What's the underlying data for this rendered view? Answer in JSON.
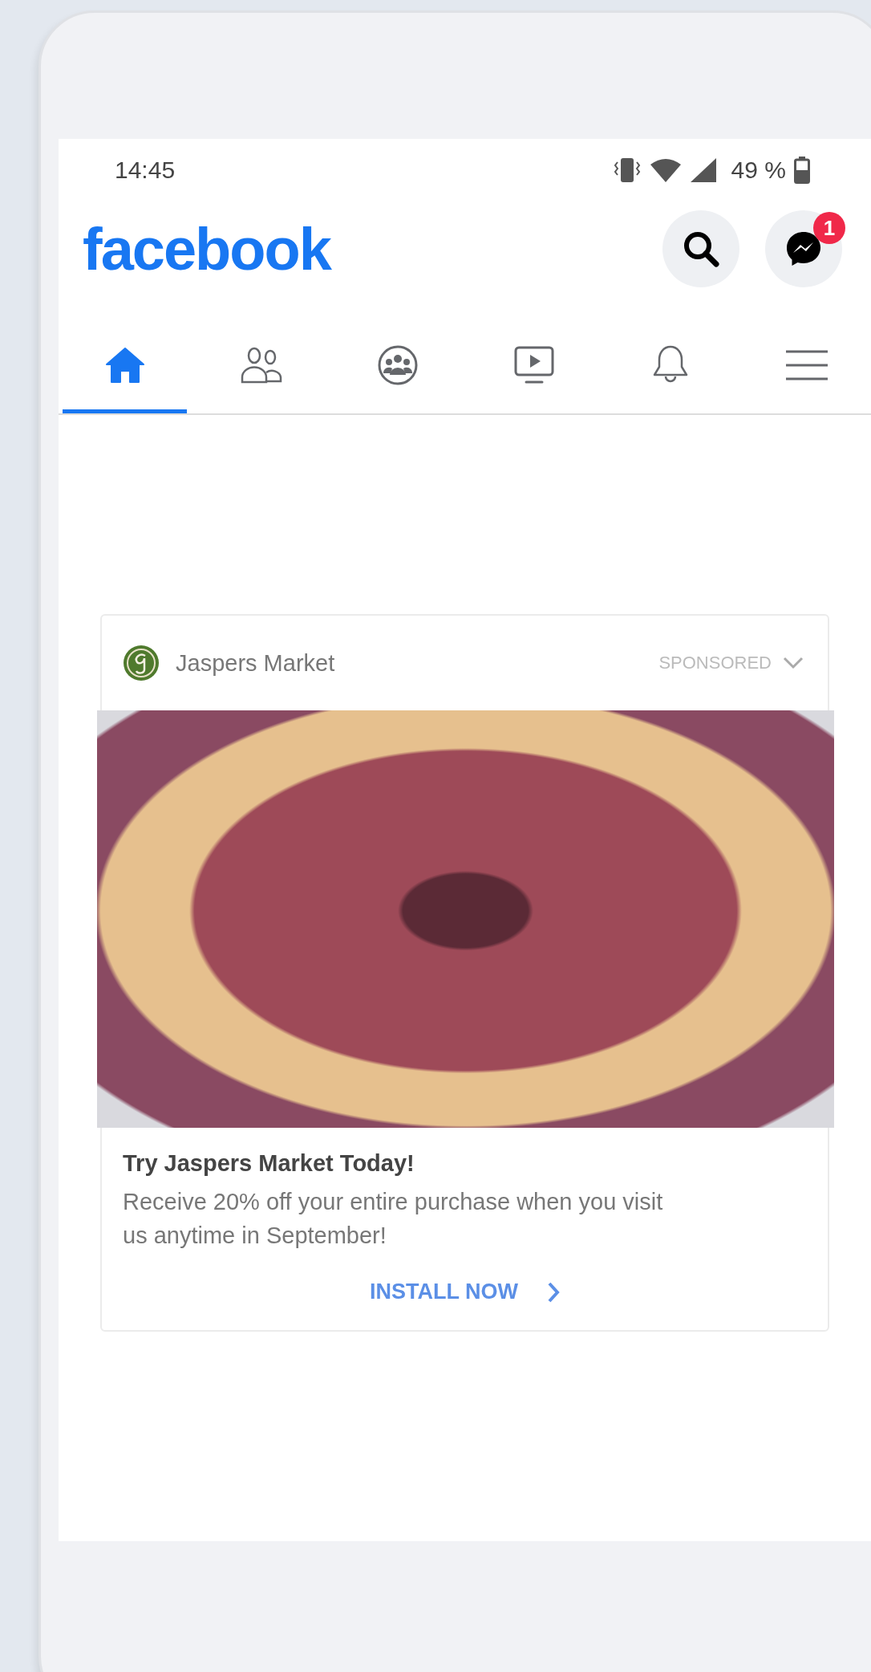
{
  "status_bar": {
    "time": "14:45",
    "battery": "49 %"
  },
  "header": {
    "logo": "facebook",
    "messenger_badge": "1"
  },
  "tabs": [
    {
      "kind": "home",
      "selected": true
    },
    {
      "kind": "friends",
      "selected": false
    },
    {
      "kind": "groups",
      "selected": false
    },
    {
      "kind": "watch",
      "selected": false
    },
    {
      "kind": "notifications",
      "selected": false
    },
    {
      "kind": "menu",
      "selected": false
    }
  ],
  "ad": {
    "advertiser": "Jaspers Market",
    "label": "SPONSORED",
    "title": "Try Jaspers Market Today!",
    "body": "Receive 20% off your entire purchase when you visit us anytime in September!",
    "cta": "INSTALL NOW"
  }
}
